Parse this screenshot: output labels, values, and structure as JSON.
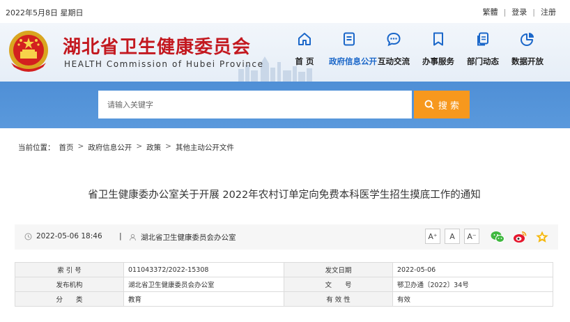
{
  "topbar": {
    "date": "2022年5月8日 星期日",
    "traditional": "繁體",
    "sep": "|",
    "login": "登录",
    "register": "注册"
  },
  "header": {
    "org_cn": "湖北省卫生健康委员会",
    "org_en": "HEALTH Commission of Hubei Province"
  },
  "nav": [
    {
      "label": "首  页",
      "icon": "home-icon"
    },
    {
      "label": "政府信息公开",
      "icon": "document-list-icon"
    },
    {
      "label": "互动交流",
      "icon": "chat-bubble-icon"
    },
    {
      "label": "办事服务",
      "icon": "bookmark-icon"
    },
    {
      "label": "部门动态",
      "icon": "copy-icon"
    },
    {
      "label": "数据开放",
      "icon": "pie-chart-icon"
    }
  ],
  "search": {
    "placeholder": "请输入关键字",
    "button": "搜 索"
  },
  "breadcrumb": {
    "prefix": "当前位置：",
    "items": [
      "首页",
      "政府信息公开",
      "政策",
      "其他主动公开文件"
    ],
    "arrow": ">"
  },
  "article": {
    "title": "省卫生健康委办公室关于开展 2022年农村订单定向免费本科医学生招生摸底工作的通知",
    "datetime": "2022-05-06 18:46",
    "sep": "|",
    "publisher": "湖北省卫生健康委员会办公室"
  },
  "font_buttons": [
    "A⁺",
    "A",
    "A⁻"
  ],
  "share_icons": [
    "wechat-icon",
    "weibo-icon",
    "favorite-star-icon"
  ],
  "info_table": {
    "rows": [
      {
        "l1": "索 引 号",
        "v1": "011043372/2022-15308",
        "l2": "发文日期",
        "v2": "2022-05-06"
      },
      {
        "l1": "发布机构",
        "v1": "湖北省卫生健康委员会办公室",
        "l2": "文　　号",
        "v2": "鄂卫办通〔2022〕34号"
      },
      {
        "l1": "分　　类",
        "v1": "教育",
        "l2": "有 效 性",
        "v2": "有效"
      }
    ]
  },
  "colors": {
    "brand_red": "#c3181f",
    "nav_blue": "#1b67c9",
    "search_band": "#5a99dc",
    "search_button": "#f7981d"
  }
}
